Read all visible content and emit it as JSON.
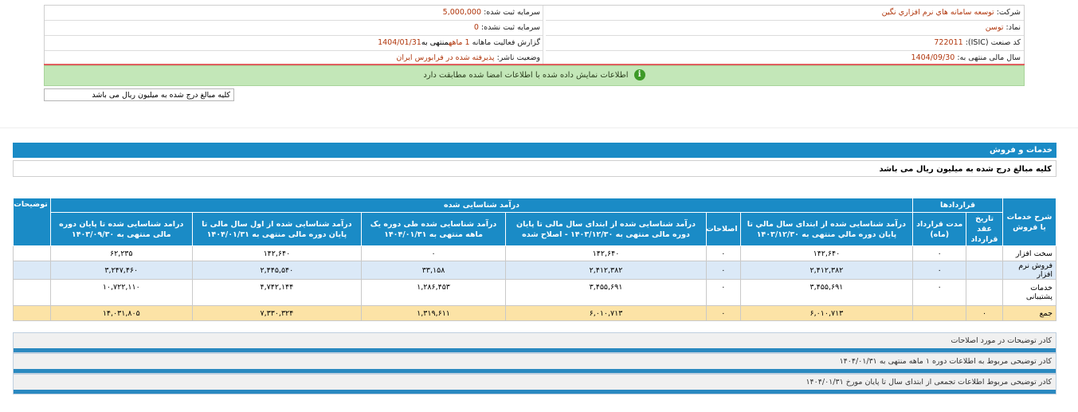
{
  "info": {
    "company_label": "شرکت:",
    "company_value": "توسعه سامانه هاي نرم افزاري نگين",
    "symbol_label": "نماد:",
    "symbol_value": "توسن",
    "isic_label": "کد صنعت (ISIC):",
    "isic_value": "722011",
    "fiscal_label": "سال مالی منتهی به:",
    "fiscal_value": "1404/09/30",
    "capital_label": "سرمایه ثبت شده:",
    "capital_value": "5,000,000",
    "unregistered_label": "سرمایه ثبت نشده:",
    "unregistered_value": "0",
    "report_label_a": "گزارش فعالیت ماهانه",
    "report_value_a": "1 ماهه",
    "report_label_b": "منتهی به",
    "report_value_b": "1404/01/31",
    "status_label": "وضعیت ناشر:",
    "status_value": "پذیرفته شده در فرابورس ایران"
  },
  "notice": {
    "icon": "info-icon",
    "icon_glyph": "i",
    "text": "اطلاعات نمایش داده شده با اطلاعات امضا شده مطابقت دارد"
  },
  "unit_note": "کلیه مبالغ درج شده به میلیون ریال می باشد",
  "section": {
    "title": "خدمات و فروش",
    "note": "کلیه مبالغ درج شده به میلیون ریال می باشد"
  },
  "table": {
    "h_desc": "شرح خدمات یا فروش",
    "h_contracts": "قرارداد‌ها",
    "h_revenue": "درآمد شناسایی شده",
    "h_notes": "توضیحات",
    "h_contract_date": "تاریخ عقد قرارداد",
    "h_contract_period": "مدت قرارداد (ماه)",
    "h_rev_from_start": "درآمد شناسايی شده از ابتدای سال مالي تا پايان دوره مالي منتهی به ۱۴۰۳/۱۲/۳۰",
    "h_corrections": "اصلاحات",
    "h_rev_corrected": "درآمد شناسايی شده از ابتدای سال مالی تا پایان دوره مالی منتهی به ۱۴۰۳/۱۲/۳۰ - اصلاح شده",
    "h_rev_period": "درآمد شناسایی شده طی دوره یک ماهه منتهی به ۱۴۰۴/۰۱/۳۱",
    "h_rev_ytd": "درآمد شناسايی شده از اول سال مالی تا پایان دوره مالی منتهی به ۱۴۰۴/۰۱/۳۱",
    "h_rev_to_year_end": "درامد شناسايی شده تا پايان دوره مالی منتهی به ۱۴۰۳/۰۹/۳۰",
    "rows": [
      {
        "desc": "سخت افزار",
        "date": "",
        "period": "۰",
        "from_start": "۱۴۲,۶۴۰",
        "corr": "۰",
        "corrected": "۱۴۲,۶۴۰",
        "rev_period": "۰",
        "ytd": "۱۴۲,۶۴۰",
        "to_year_end": "۶۲,۲۳۵",
        "notes": ""
      },
      {
        "desc": "فروش نرم افزار",
        "date": "",
        "period": "۰",
        "from_start": "۲,۴۱۲,۳۸۲",
        "corr": "۰",
        "corrected": "۲,۴۱۲,۳۸۲",
        "rev_period": "۳۳,۱۵۸",
        "ytd": "۲,۴۴۵,۵۴۰",
        "to_year_end": "۳,۲۴۷,۴۶۰",
        "notes": ""
      },
      {
        "desc": "خدمات پشتیبانی",
        "date": "",
        "period": "۰",
        "from_start": "۳,۴۵۵,۶۹۱",
        "corr": "۰",
        "corrected": "۳,۴۵۵,۶۹۱",
        "rev_period": "۱,۲۸۶,۴۵۳",
        "ytd": "۴,۷۴۲,۱۴۴",
        "to_year_end": "۱۰,۷۲۲,۱۱۰",
        "notes": ""
      },
      {
        "desc": "جمع",
        "date": "۰",
        "period": "",
        "from_start": "۶,۰۱۰,۷۱۳",
        "corr": "۰",
        "corrected": "۶,۰۱۰,۷۱۳",
        "rev_period": "۱,۳۱۹,۶۱۱",
        "ytd": "۷,۳۳۰,۳۲۴",
        "to_year_end": "۱۴,۰۳۱,۸۰۵",
        "notes": ""
      }
    ]
  },
  "comments": [
    "کادر توضیحات در مورد اصلاحات",
    "کادر توضیحی مربوط به اطلاعات دوره ۱ ماهه منتهی به ۱۴۰۴/۰۱/۳۱",
    "کادر توضیحی مربوط اطلاعات تجمعی از ابتدای سال تا پایان مورخ ۱۴۰۴/۰۱/۳۱"
  ],
  "colors": {
    "header_blue": "#1a8bc6",
    "row_alt": "#dbe9f7",
    "total_row": "#fce3a6",
    "notice_green": "#c3e7b8",
    "value_red": "#b0360c"
  }
}
